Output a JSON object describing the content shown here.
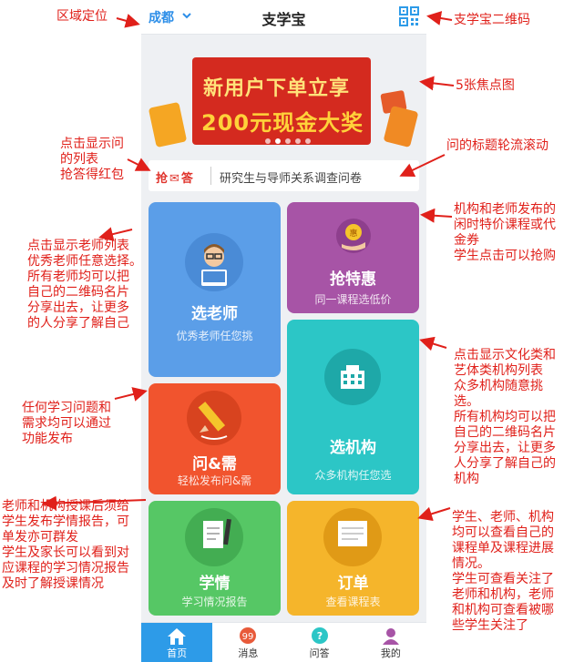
{
  "app": {
    "city": "成都",
    "title": "支学宝"
  },
  "banner": {
    "line1": "新用户下单立享",
    "line2": "200元现金大奖",
    "dot_count": 5,
    "active_dot": 1
  },
  "qa_bar": {
    "logo": "抢✉答",
    "headline": "研究生与导师关系调查问卷"
  },
  "tiles": {
    "teacher": {
      "title": "选老师",
      "subtitle": "优秀老师任您挑"
    },
    "deal": {
      "title": "抢特惠",
      "subtitle": "同一课程选低价"
    },
    "org": {
      "title": "选机构",
      "subtitle": "众多机构任您选"
    },
    "qa": {
      "title": "问&需",
      "subtitle": "轻松发布问&需"
    },
    "report": {
      "title": "学情",
      "subtitle": "学习情况报告"
    },
    "order": {
      "title": "订单",
      "subtitle": "查看课程表"
    }
  },
  "tabbar": [
    {
      "label": "首页",
      "icon": "home-icon",
      "active": true
    },
    {
      "label": "消息",
      "icon": "message-icon",
      "active": false
    },
    {
      "label": "问答",
      "icon": "question-icon",
      "active": false
    },
    {
      "label": "我的",
      "icon": "profile-icon",
      "active": false
    }
  ],
  "annotations": {
    "region": "区域定位",
    "qrcode": "支学宝二维码",
    "banner": "5张焦点图",
    "qa_list": "点击显示问\n的列表\n抢答得红包",
    "headline_scroll": "问的标题轮流滚动",
    "teacher": "点击显示老师列表\n优秀老师任意选择。\n所有老师均可以把\n自己的二维码名片\n分享出去，让更多\n的人分享了解自己",
    "deal": "机构和老师发布的\n闲时特价课程或代\n金券\n学生点击可以抢购",
    "org": "点击显示文化类和\n艺体类机构列表\n众多机构随意挑\n选。\n所有机构均可以把\n自己的二维码名片\n分享出去，让更多\n人分享了解自己的\n机构",
    "qa_publish": "任何学习问题和\n需求均可以通过\n功能发布",
    "report": "老师和机构授课后须给\n学生发布学情报告，可\n单发亦可群发\n学生及家长可以看到对\n应课程的学习情况报告\n及时了解授课情况",
    "order": "学生、老师、机构\n均可以查看自己的\n课程单及课程进展\n情况。\n学生可查看关注了\n老师和机构，老师\n和机构可查看被哪\n些学生关注了"
  },
  "colors": {
    "accent": "#2d9be8",
    "annotation": "#e0201a",
    "teacher": "#5b9ee8",
    "deal": "#a754a6",
    "org": "#2cc6c6",
    "qa": "#f1542e",
    "report": "#56c765",
    "order": "#f5b52b"
  }
}
